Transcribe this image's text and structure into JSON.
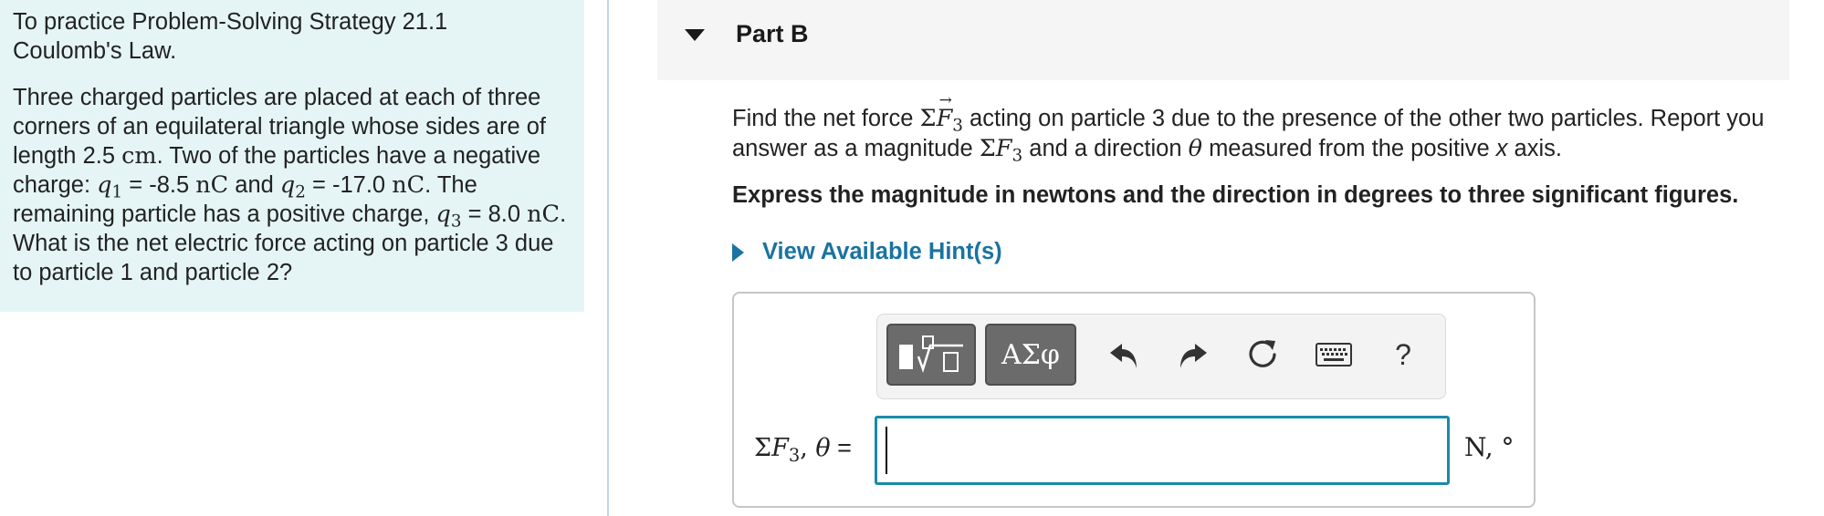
{
  "intro": {
    "heading_line1": "To practice Problem-Solving Strategy 21.1",
    "heading_line2": "Coulomb's Law.",
    "t1": "Three charged particles are placed at each of three corners of an equilateral triangle whose sides are of length ",
    "side_value": "2.5",
    "side_unit": "cm",
    "t2": ". Two of the particles have a negative charge: ",
    "q1_sym": "q",
    "q1_sub": "1",
    "q1_eq": " = -8.5 ",
    "q1_unit": "nC",
    "t3": " and ",
    "q2_sym": "q",
    "q2_sub": "2",
    "q2_eq": " = -17.0 ",
    "q2_unit": "nC",
    "t4": ". The remaining particle has a positive charge, ",
    "q3_sym": "q",
    "q3_sub": "3",
    "q3_eq": " = 8.0 ",
    "q3_unit": "nC",
    "t5": ". What is the net electric force acting on particle 3 due to particle 1 and particle 2?"
  },
  "part": {
    "title": "Part B"
  },
  "question": {
    "t1": "Find the net force ",
    "sum_symbol": "Σ",
    "force_symbol": "F",
    "vector_arrow": "→",
    "force_sub": "3",
    "t2": " acting on particle 3 due to the presence of the other two particles. Report you answer as a magnitude ",
    "mag_sum": "Σ",
    "mag_force": "F",
    "mag_sub": "3",
    "t3": " and a direction ",
    "theta": "θ",
    "t4": " measured from the positive ",
    "axis": "x",
    "t5": " axis."
  },
  "instruction": "Express the magnitude in newtons and the direction in degrees to three significant figures.",
  "hint": {
    "label": "View Available Hint(s)"
  },
  "toolbar": {
    "symbols_label": "ΑΣφ",
    "help_label": "?"
  },
  "answer": {
    "label_sum": "Σ",
    "label_force": "F",
    "label_sub": "3",
    "label_sep": ", ",
    "label_theta": "θ",
    "label_eq": " =",
    "value": "",
    "units": "N, °"
  },
  "colors": {
    "intro_bg": "#e5f5f5",
    "link_blue": "#1a73a0",
    "input_border": "#1a8aa8",
    "toolbar_button": "#6b6b6b"
  },
  "icons": [
    "triangle-down-icon",
    "triangle-right-icon",
    "templates-icon",
    "undo-icon",
    "redo-icon",
    "reset-icon",
    "keyboard-icon"
  ]
}
